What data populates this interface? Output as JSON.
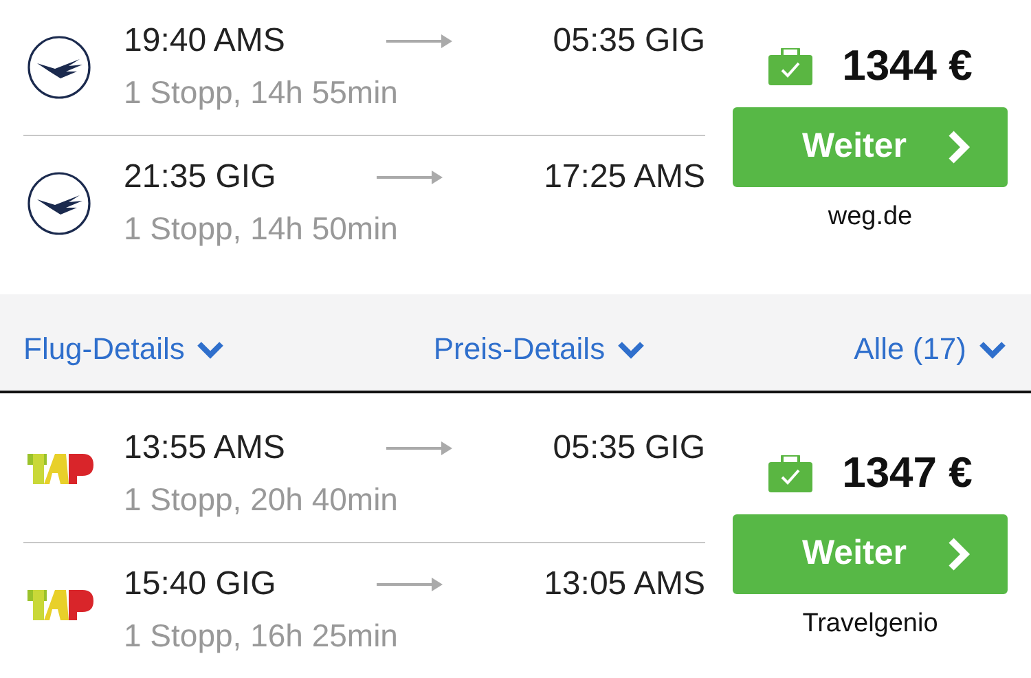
{
  "results": [
    {
      "legs": [
        {
          "logo": {
            "kind": "roundel"
          },
          "depart": "19:40 AMS",
          "arrive": "05:35 GIG",
          "summary": "1 Stopp, 14h 55min"
        },
        {
          "logo": {
            "kind": "roundel"
          },
          "depart": "21:35 GIG",
          "arrive": "17:25 AMS",
          "summary": "1 Stopp, 14h 50min"
        }
      ],
      "price": "1344 €",
      "button": "Weiter",
      "provider": "weg.de",
      "details_bar": {
        "links": [
          "Flug-Details",
          "Preis-Details",
          "Alle (17)"
        ]
      }
    },
    {
      "legs": [
        {
          "logo": {
            "kind": "blocks"
          },
          "depart": "13:55 AMS",
          "arrive": "05:35 GIG",
          "summary": "1 Stopp, 20h 40min"
        },
        {
          "logo": {
            "kind": "blocks"
          },
          "depart": "15:40 GIG",
          "arrive": "13:05 AMS",
          "summary": "1 Stopp, 16h 25min"
        }
      ],
      "price": "1347 €",
      "button": "Weiter",
      "provider": "Travelgenio"
    }
  ]
}
